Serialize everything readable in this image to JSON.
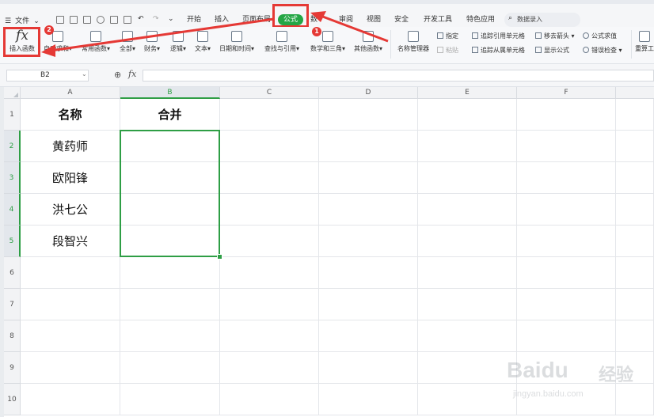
{
  "menubar": {
    "file_label": "文件",
    "tabs": [
      "开始",
      "插入",
      "页面布局",
      "公式",
      "数",
      "审阅",
      "视图",
      "安全",
      "开发工具",
      "特色应用"
    ],
    "active_tab": "公式",
    "search_placeholder": "数据录入"
  },
  "ribbon": {
    "insert_function": "插入函数",
    "fx_symbol": "fx",
    "groups": [
      "自动求和",
      "常用函数",
      "全部",
      "财务",
      "逻辑",
      "文本",
      "日期和时间",
      "查找与引用",
      "数学和三角",
      "其他函数"
    ],
    "name_manager": "名称管理器",
    "specify": "指定",
    "paste": "粘贴",
    "trace_precedents": "追踪引用单元格",
    "trace_dependents": "追踪从属单元格",
    "remove_arrows": "移去箭头",
    "show_formulas": "显示公式",
    "evaluate_formula": "公式求值",
    "error_checking": "错误检查",
    "recalc": "重算工"
  },
  "formula_bar": {
    "name_box": "B2",
    "fx": "fx",
    "value": ""
  },
  "sheet": {
    "columns": [
      "A",
      "B",
      "C",
      "D",
      "E",
      "F"
    ],
    "rows": [
      "1",
      "2",
      "3",
      "4",
      "5",
      "6",
      "7",
      "8",
      "9",
      "10"
    ],
    "cells": {
      "A1": "名称",
      "B1": "合并",
      "A2": "黄药师",
      "A3": "欧阳锋",
      "A4": "洪七公",
      "A5": "段智兴"
    },
    "selected_range": "B2:B5"
  },
  "annotations": {
    "badge1": "1",
    "badge2": "2",
    "arrow_color": "#e53935"
  },
  "watermark": {
    "brand": "Baidu",
    "brand_cn": "经验",
    "url": "jingyan.baidu.com"
  },
  "colors": {
    "accent_green": "#24a645",
    "selection_green": "#2e9e45",
    "annotation_red": "#e53935"
  }
}
